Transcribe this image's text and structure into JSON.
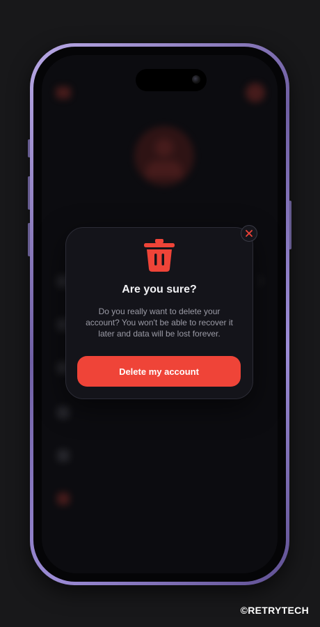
{
  "modal": {
    "title": "Are you sure?",
    "message": "Do you really want to delete your account? You won't be able to recover it later and data will be lost forever.",
    "delete_label": "Delete my account",
    "close_icon": "close-icon",
    "trash_icon": "trash-icon"
  },
  "watermark": "©RETRYTECH",
  "colors": {
    "accent": "#ef4438",
    "modal_bg": "#14141a",
    "background": "#18181a",
    "phone_frame": "#9c8cd6"
  }
}
